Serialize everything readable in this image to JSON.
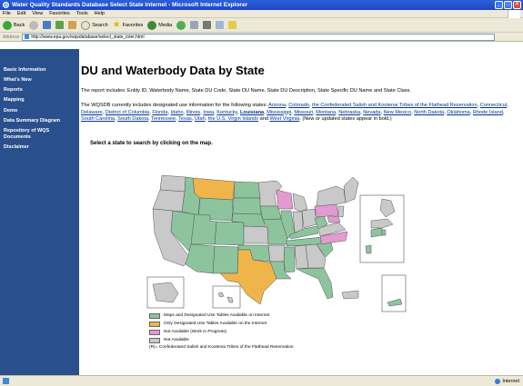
{
  "window": {
    "title": "Water Quality Standards Database Select State Internet - Microsoft Internet Explorer"
  },
  "menu": [
    "File",
    "Edit",
    "View",
    "Favorites",
    "Tools",
    "Help"
  ],
  "toolbar": {
    "back": "Back",
    "search": "Search",
    "favorites": "Favorites",
    "media": "Media"
  },
  "address": {
    "label": "Address",
    "url": "http://www.epa.gov/wqsdatabase/select_state_inter.html"
  },
  "sidebar": {
    "items": [
      {
        "label": "Basic Information"
      },
      {
        "label": "What's New"
      },
      {
        "label": "Reports"
      },
      {
        "label": "Mapping"
      },
      {
        "label": "Demo"
      },
      {
        "label": "Data Summary Diagram"
      },
      {
        "label": "Repository of WQS Documents"
      },
      {
        "label": "Disclaimer"
      }
    ]
  },
  "main": {
    "title": "DU and Waterbody Data by State",
    "report_text": "The report includes: Entity ID, Waterbody Name, State DU Code, State DU Name, State DU Description, State Specific DU Name and State Class.",
    "states_intro": "The WQSDB currently includes designated use information for the following states: ",
    "states": [
      {
        "name": "Arizona",
        "bold": false
      },
      {
        "name": "Colorado",
        "bold": false
      },
      {
        "name": "the Confederated Salish and Kootenai Tribes of the Flathead Reservation",
        "bold": false
      },
      {
        "name": "Connecticut",
        "bold": false
      },
      {
        "name": "Delaware",
        "bold": false
      },
      {
        "name": "District of Columbia",
        "bold": false
      },
      {
        "name": "Florida",
        "bold": false
      },
      {
        "name": "Idaho",
        "bold": false
      },
      {
        "name": "Illinois",
        "bold": false
      },
      {
        "name": "Iowa",
        "bold": false
      },
      {
        "name": "Kentucky",
        "bold": false
      },
      {
        "name": "Louisiana",
        "bold": true
      },
      {
        "name": "Mississippi",
        "bold": false
      },
      {
        "name": "Missouri",
        "bold": false
      },
      {
        "name": "Montana",
        "bold": false
      },
      {
        "name": "Nebraska",
        "bold": false
      },
      {
        "name": "Nevada",
        "bold": false
      },
      {
        "name": "New Mexico",
        "bold": false
      },
      {
        "name": "North Dakota",
        "bold": false
      },
      {
        "name": "Oklahoma",
        "bold": false
      },
      {
        "name": "Rhode Island",
        "bold": false
      },
      {
        "name": "South Carolina",
        "bold": false
      },
      {
        "name": "South Dakota",
        "bold": false
      },
      {
        "name": "Tennessee",
        "bold": false
      },
      {
        "name": "Texas",
        "bold": false
      },
      {
        "name": "Utah",
        "bold": false
      },
      {
        "name": "the U.S. Virgin Islands",
        "bold": false
      },
      {
        "name": "West Virginia",
        "bold": false
      }
    ],
    "states_outro": ". (New or updated states appear in bold.)",
    "instruction": "Select a state to search by clicking on the map."
  },
  "legend": {
    "items": [
      {
        "label": "Maps and Designated Use Tables Available on Internet",
        "color": "#8dc49e"
      },
      {
        "label": "Only Designated Use Tables Available on the Internet",
        "color": "#f0b54a"
      },
      {
        "label": "Not Available (Work in Progress)",
        "color": "#e39ad0"
      },
      {
        "label": "Not Available",
        "color": "#c9c9c9"
      }
    ],
    "note": "(R)= Confederated Salish and Kootenai Tribes of the Flathead Reservation"
  },
  "colors": {
    "sidebar": "#2a4f8d",
    "green": "#8dc49e",
    "orange": "#f0b54a",
    "pink": "#e39ad0",
    "grey": "#c9c9c9"
  },
  "statusbar": {
    "zone": "Internet"
  }
}
